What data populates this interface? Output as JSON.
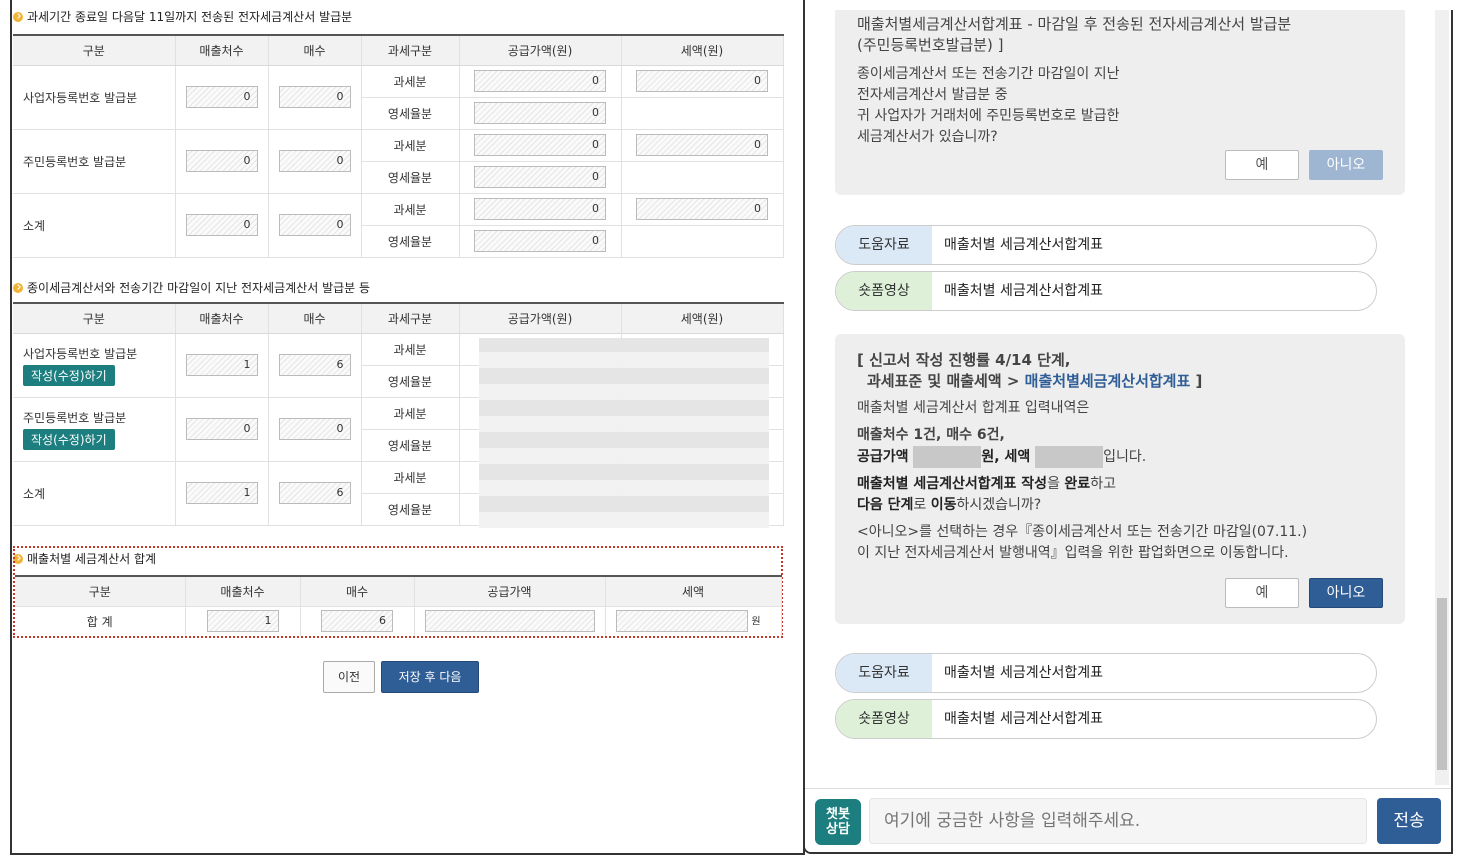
{
  "sections": {
    "s1_title": "과세기간 종료일 다음달 11일까지 전송된 전자세금계산서 발급분",
    "s2_title": "종이세금계산서와 전송기간 마감일이 지난 전자세금계산서 발급분 등",
    "s3_title": "매출처별 세금계산서 합계"
  },
  "headers": {
    "gubun": "구분",
    "customers": "매출처수",
    "count": "매수",
    "tax_type": "과세구분",
    "supply": "공급가액(원)",
    "tax": "세액(원)",
    "supply_short": "공급가액",
    "tax_short": "세액"
  },
  "rows": {
    "biz": "사업자등록번호 발급분",
    "resident": "주민등록번호 발급분",
    "subtotal": "소계",
    "taxable": "과세분",
    "zero": "영세율분",
    "total": "합 계",
    "edit_btn": "작성(수정)하기"
  },
  "t1": {
    "biz_customers": "0",
    "biz_count": "0",
    "biz_supply_tax": "0",
    "biz_supply_zero": "0",
    "biz_tax": "0",
    "res_customers": "0",
    "res_count": "0",
    "res_supply_tax": "0",
    "res_supply_zero": "0",
    "res_tax": "0",
    "sub_customers": "0",
    "sub_count": "0",
    "sub_supply_tax": "0",
    "sub_supply_zero": "0",
    "sub_tax": "0"
  },
  "t2": {
    "biz_customers": "1",
    "biz_count": "6",
    "res_customers": "0",
    "res_count": "0",
    "sub_customers": "1",
    "sub_count": "6"
  },
  "sum": {
    "customers": "1",
    "count": "6",
    "unit": "원"
  },
  "buttons": {
    "prev": "이전",
    "next": "저장 후 다음"
  },
  "chat": {
    "card1_link1": "매출처별세금계산서합계표 - 마감일 후 전송된 전자세금계산서 발급분",
    "card1_link2": "(주민등록번호발급분) ]",
    "card1_q1": "종이세금계산서 또는 전송기간 마감일이 지난",
    "card1_q2": "전자세금계산서 발급분 중",
    "card1_q3": "귀 사업자가 거래처에 주민등록번호로 발급한",
    "card1_q4": "세금계산서가 있습니까?",
    "yes": "예",
    "no": "아니오",
    "help_tag": "도움자료",
    "video_tag": "숏폼영상",
    "help_text": "매출처별 세금계산서합계표",
    "video_text": "매출처별 세금계산서합계표",
    "card2_l1": "[ 신고서 작성 진행률 4/14 단계,",
    "card2_l2a": "과세표준 및 매출세액 > ",
    "card2_l2b": "매출처별세금계산서합계표",
    "card2_l2c": " ]",
    "card2_l3": "매출처별 세금계산서 합계표 입력내역은",
    "card2_l4": "매출처수 1건, 매수 6건,",
    "card2_l5a": "공급가액 ",
    "card2_l5b": "원, 세액 ",
    "card2_l5c": "입니다.",
    "card2_l6a": "매출처별 세금계산서합계표 작성",
    "card2_l6b": "을 ",
    "card2_l6c": "완료",
    "card2_l6d": "하고",
    "card2_l7a": "다음 단계",
    "card2_l7b": "로 ",
    "card2_l7c": "이동",
    "card2_l7d": "하시겠습니까?",
    "card2_l8": "<아니오>를 선택하는 경우『종이세금계산서 또는 전송기간 마감일(07.11.)",
    "card2_l9": "이 지난 전자세금계산서 발행내역』입력을 위한 팝업화면으로 이동합니다.",
    "bot_label_1": "챗봇",
    "bot_label_2": "상담",
    "input_placeholder": "여기에 궁금한 사항을 입력해주세요.",
    "send": "전송"
  },
  "colors": {
    "primary": "#2f5d95",
    "teal": "#1c7e7e",
    "highlight": "#c0392b"
  }
}
